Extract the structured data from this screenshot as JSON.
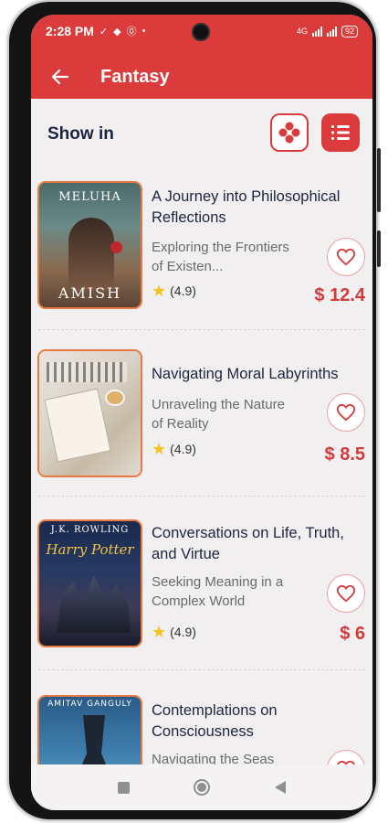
{
  "status_bar": {
    "time": "2:28 PM",
    "network": "4G",
    "battery": "92"
  },
  "app_bar": {
    "title": "Fantasy",
    "back_icon": "arrow-left-icon"
  },
  "view_toggle": {
    "label": "Show in",
    "grid_icon": "grid-view-icon",
    "list_icon": "list-view-icon"
  },
  "books": [
    {
      "title": "A Journey into Philosophical Reflections",
      "subtitle": "Exploring the Frontiers of Existen...",
      "rating": "(4.9)",
      "price": "$ 12.4",
      "cover_top_text": "MELUHA",
      "cover_bottom_text": "AMISH"
    },
    {
      "title": "Navigating Moral Labyrinths",
      "subtitle": "Unraveling the Nature of Reality",
      "rating": "(4.9)",
      "price": "$ 8.5",
      "cover_top_text": "",
      "cover_bottom_text": ""
    },
    {
      "title": "Conversations on Life, Truth, and Virtue",
      "subtitle": "Seeking Meaning in a Complex World",
      "rating": "(4.9)",
      "price": "$ 6",
      "cover_top_text": "J.K. ROWLING",
      "cover_bottom_text": "Harry Potter"
    },
    {
      "title": "Contemplations on Consciousness",
      "subtitle": "Navigating the Seas",
      "rating": "",
      "price": "",
      "cover_top_text": "AMITAV GANGULY",
      "cover_bottom_text": ""
    }
  ],
  "colors": {
    "primary": "#dc3b3b",
    "background": "#f1efef",
    "title_text": "#1d2540",
    "price": "#d43a3a",
    "star": "#f4c21b"
  }
}
